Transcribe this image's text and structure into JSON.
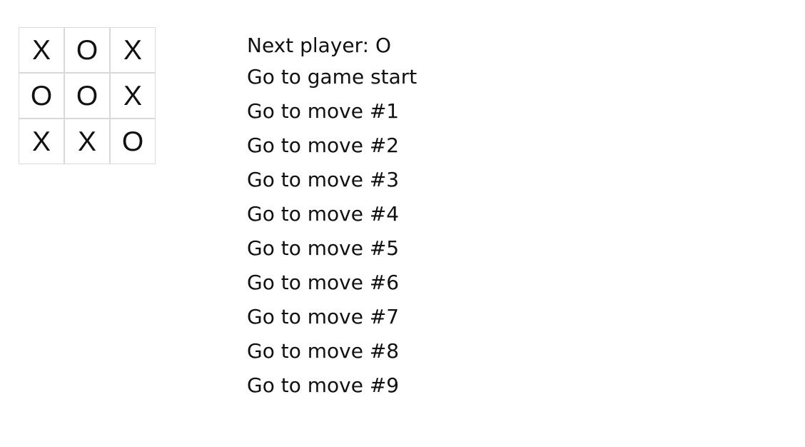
{
  "board": {
    "cells": [
      "X",
      "O",
      "X",
      "O",
      "O",
      "X",
      "X",
      "X",
      "O"
    ]
  },
  "status": "Next player: O",
  "moves": [
    "Go to game start",
    "Go to move #1",
    "Go to move #2",
    "Go to move #3",
    "Go to move #4",
    "Go to move #5",
    "Go to move #6",
    "Go to move #7",
    "Go to move #8",
    "Go to move #9"
  ],
  "colors": {
    "text": "#111111",
    "cell_border": "#d9d9d9",
    "background": "#ffffff"
  }
}
